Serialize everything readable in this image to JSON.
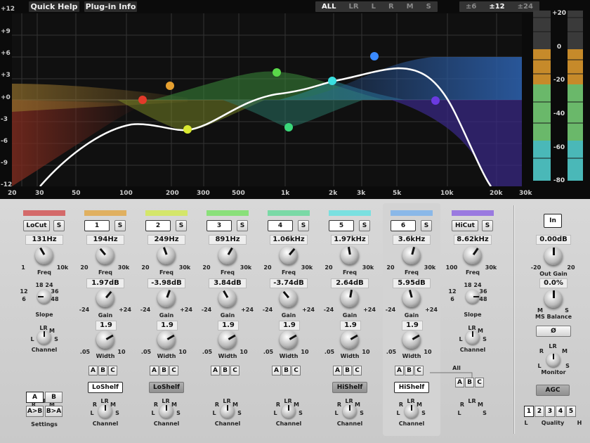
{
  "topbar": {
    "quick_help": "Quick Help",
    "plugin_info": "Plug-in Info",
    "channels": [
      "ALL",
      "LR",
      "L",
      "R",
      "M",
      "S"
    ],
    "channel_selected": "ALL",
    "ranges": [
      "±6",
      "±12",
      "±24"
    ],
    "range_selected": "±12"
  },
  "graph": {
    "db_labels": [
      "+12",
      "+9",
      "+6",
      "+3",
      "+0",
      "-3",
      "-6",
      "-9",
      "-12"
    ],
    "freq_labels": [
      "20",
      "30",
      "50",
      "100",
      "200",
      "300",
      "500",
      "1k",
      "2k",
      "3k",
      "5k",
      "10k",
      "20k",
      "30k"
    ]
  },
  "meter": {
    "labels": [
      "+20",
      "0",
      "-20",
      "-40",
      "-60",
      "-80"
    ],
    "level_left": 0.78,
    "level_right": 0.78
  },
  "bands": [
    {
      "type": "LoCut",
      "solo": "S",
      "freq": "131Hz",
      "freq_range": [
        "1",
        "10k"
      ],
      "freq_label": "Freq",
      "color": "#d46a6a",
      "slope_label": "Slope",
      "slope_ticks": [
        "18",
        "24",
        "12",
        "36",
        "6",
        "48"
      ],
      "channel_label": "Channel",
      "ch_ticks": [
        "LR",
        "M",
        "L",
        "S"
      ]
    },
    {
      "type": "1",
      "solo": "S",
      "freq": "194Hz",
      "freq_range": [
        "20",
        "30k"
      ],
      "freq_label": "Freq",
      "gain": "1.97dB",
      "gain_range": [
        "-24",
        "+24"
      ],
      "gain_label": "Gain",
      "width": "1.9",
      "width_range": [
        ".05",
        "10"
      ],
      "width_label": "Width",
      "color": "#e0b060",
      "shape": "LoShelf",
      "shape_on": true,
      "channel_label": "Channel"
    },
    {
      "type": "2",
      "solo": "S",
      "freq": "249Hz",
      "freq_range": [
        "20",
        "30k"
      ],
      "freq_label": "Freq",
      "gain": "-3.98dB",
      "gain_range": [
        "-24",
        "+24"
      ],
      "gain_label": "Gain",
      "width": "1.9",
      "width_range": [
        ".05",
        "10"
      ],
      "width_label": "Width",
      "color": "#d4e66a",
      "shape": "LoShelf",
      "shape_on": false,
      "channel_label": "Channel"
    },
    {
      "type": "3",
      "solo": "S",
      "freq": "891Hz",
      "freq_range": [
        "20",
        "30k"
      ],
      "freq_label": "Freq",
      "gain": "3.84dB",
      "gain_range": [
        "-24",
        "+24"
      ],
      "gain_label": "Gain",
      "width": "1.9",
      "width_range": [
        ".05",
        "10"
      ],
      "width_label": "Width",
      "color": "#8ae07a",
      "channel_label": "Channel"
    },
    {
      "type": "4",
      "solo": "S",
      "freq": "1.06kHz",
      "freq_range": [
        "20",
        "30k"
      ],
      "freq_label": "Freq",
      "gain": "-3.74dB",
      "gain_range": [
        "-24",
        "+24"
      ],
      "gain_label": "Gain",
      "width": "1.9",
      "width_range": [
        ".05",
        "10"
      ],
      "width_label": "Width",
      "color": "#7ad9a6",
      "channel_label": "Channel"
    },
    {
      "type": "5",
      "solo": "S",
      "freq": "1.97kHz",
      "freq_range": [
        "20",
        "30k"
      ],
      "freq_label": "Freq",
      "gain": "2.64dB",
      "gain_range": [
        "-24",
        "+24"
      ],
      "gain_label": "Gain",
      "width": "1.9",
      "width_range": [
        ".05",
        "10"
      ],
      "width_label": "Width",
      "color": "#7ae0e0",
      "shape": "HiShelf",
      "shape_on": false,
      "channel_label": "Channel"
    },
    {
      "type": "6",
      "solo": "S",
      "freq": "3.6kHz",
      "freq_range": [
        "20",
        "30k"
      ],
      "freq_label": "Freq",
      "gain": "5.95dB",
      "gain_range": [
        "-24",
        "+24"
      ],
      "gain_label": "Gain",
      "width": "1.9",
      "width_range": [
        ".05",
        "10"
      ],
      "width_label": "Width",
      "color": "#8ab8e8",
      "shape": "HiShelf",
      "shape_on": true,
      "channel_label": "Channel"
    },
    {
      "type": "HiCut",
      "solo": "S",
      "freq": "8.62kHz",
      "freq_range": [
        "100",
        "30k"
      ],
      "freq_label": "Freq",
      "color": "#9a7ae0",
      "slope_label": "Slope",
      "slope_ticks": [
        "18",
        "24",
        "12",
        "36",
        "6",
        "48"
      ],
      "channel_label": "Channel",
      "ch_ticks": [
        "LR",
        "M",
        "L",
        "S"
      ]
    }
  ],
  "abc": [
    "A",
    "B",
    "C"
  ],
  "all_label": "All",
  "settings": {
    "a": "A",
    "b": "B",
    "a_to_b": "A>B",
    "b_to_a": "B>A",
    "label": "Settings"
  },
  "output": {
    "in": "In",
    "out_gain": "0.00dB",
    "out_gain_range": [
      "-20",
      "20"
    ],
    "out_gain_label": "Out Gain",
    "ms_balance": "0.0%",
    "ms_range": [
      "M",
      "S"
    ],
    "ms_label": "MS Balance",
    "phase": "Ø",
    "monitor_label": "Monitor",
    "agc": "AGC",
    "quality": [
      "1",
      "2",
      "3",
      "4",
      "5"
    ],
    "quality_selected": "1",
    "quality_label": "Quality",
    "quality_range": [
      "L",
      "H"
    ]
  }
}
